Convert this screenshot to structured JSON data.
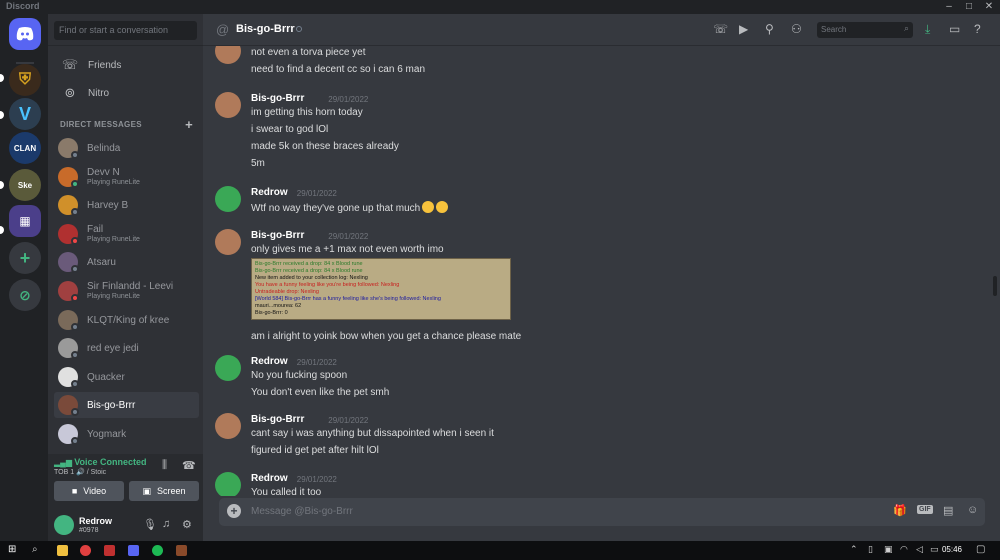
{
  "window": {
    "title": "Discord"
  },
  "servers": [
    {
      "name": "Discord Home",
      "icon": "discord-logo-icon",
      "color": "#5865f2"
    },
    {
      "name": "Warrior",
      "icon": "helmet-icon",
      "color": "#3a2a1c"
    },
    {
      "name": "V",
      "icon": "v-logo-icon",
      "color": "#2c3e50"
    },
    {
      "name": "CLAN",
      "label": "CLAN",
      "icon": "clan-icon",
      "color": "#1b3a6b"
    },
    {
      "name": "Ske",
      "label": "Ske",
      "icon": "ske-icon",
      "color": "#5a5a3a"
    },
    {
      "name": "Folder",
      "icon": "folder-icon",
      "color": "#4b3f8a"
    }
  ],
  "sidebar": {
    "search_placeholder": "Find or start a conversation",
    "nav": [
      {
        "label": "Friends",
        "icon": "friends-icon"
      },
      {
        "label": "Nitro",
        "icon": "nitro-icon"
      }
    ],
    "dm_header": "DIRECT MESSAGES",
    "dms": [
      {
        "name": "Belinda",
        "sub": "",
        "status": "offline",
        "color": "#8a7a6a"
      },
      {
        "name": "Devv N",
        "sub": "Playing RuneLite",
        "status": "online",
        "color": "#c86b2a"
      },
      {
        "name": "Harvey B",
        "sub": "",
        "status": "offline",
        "color": "#d0902a"
      },
      {
        "name": "Fail",
        "sub": "Playing RuneLite",
        "status": "dnd",
        "color": "#b03030"
      },
      {
        "name": "Atsaru",
        "sub": "",
        "status": "offline",
        "color": "#6a5a7a"
      },
      {
        "name": "Sir Finlandd - Leevi",
        "sub": "Playing RuneLite",
        "status": "dnd",
        "color": "#a04040"
      },
      {
        "name": "KLQT/King of kree",
        "sub": "",
        "status": "offline",
        "color": "#7a6a5a"
      },
      {
        "name": "red eye jedi",
        "sub": "",
        "status": "offline",
        "color": "#9a9a9a"
      },
      {
        "name": "Quacker",
        "sub": "",
        "status": "offline",
        "color": "#e0e0e0"
      },
      {
        "name": "Bis-go-Brrr",
        "sub": "",
        "status": "offline",
        "color": "#7a4a3a"
      },
      {
        "name": "Yogmark",
        "sub": "",
        "status": "offline",
        "color": "#c8c8d8"
      }
    ],
    "voice": {
      "status": "Voice Connected",
      "channel": "TOB 1 🔊 / Stoic",
      "video_label": "Video",
      "screen_label": "Screen"
    },
    "user": {
      "name": "Redrow",
      "tag": "#0978"
    }
  },
  "header": {
    "channel": "Bis-go-Brrr",
    "search_placeholder": "Search"
  },
  "messages": [
    {
      "author": "",
      "time": "",
      "lines": [
        "not even a torva piece yet",
        "need to find a decent cc so i can 6 man"
      ],
      "avatar": "bis"
    },
    {
      "author": "Bis-go-Brrr",
      "time": "29/01/2022",
      "lines": [
        "im getting this horn today",
        "i swear to god lOl",
        "made 5k on these braces already",
        "5m"
      ],
      "avatar": "bis"
    },
    {
      "author": "Redrow",
      "time": "29/01/2022",
      "lines": [
        "Wtf no way they've gone up that much"
      ],
      "avatar": "red"
    },
    {
      "author": "Bis-go-Brrr",
      "time": "29/01/2022",
      "lines": [
        "only gives me a +1 max not even worth imo"
      ],
      "attachment": [
        "Bis-go-Brrr received a drop: 84 x Blood rune",
        "Bis-go-Brrr received a drop: 84 x Blood rune",
        "New item added to your collection log: Nexling",
        "You have a funny feeling like you're being followed: Nexling",
        "Untradeable drop: Nexling",
        "[World 584] Bis-go-Brrr has a funny feeling like she's being followed: Nexling",
        "mauri...mourea: 62",
        "Bis-go-Brrr: 0"
      ],
      "after": "am i alright to yoink bow when you get a chance please mate",
      "avatar": "bis"
    },
    {
      "author": "Redrow",
      "time": "29/01/2022",
      "lines": [
        "No you fucking spoon",
        "You don't even like the pet smh"
      ],
      "avatar": "red"
    },
    {
      "author": "Bis-go-Brrr",
      "time": "29/01/2022",
      "lines": [
        "cant say i was anything but dissapointed when i seen it",
        "figured id get pet after hilt lOl"
      ],
      "avatar": "bis"
    },
    {
      "author": "Redrow",
      "time": "29/01/2022",
      "lines": [
        "You called it too"
      ],
      "avatar": "red"
    }
  ],
  "composer": {
    "placeholder": "Message @Bis-go-Brrr",
    "gif_label": "GIF"
  },
  "taskbar": {
    "time": "05:46"
  },
  "colors": {
    "bg": "#36393f",
    "sidebar": "#2f3136",
    "rail": "#202225",
    "online": "#43b581",
    "dnd": "#f04747"
  }
}
